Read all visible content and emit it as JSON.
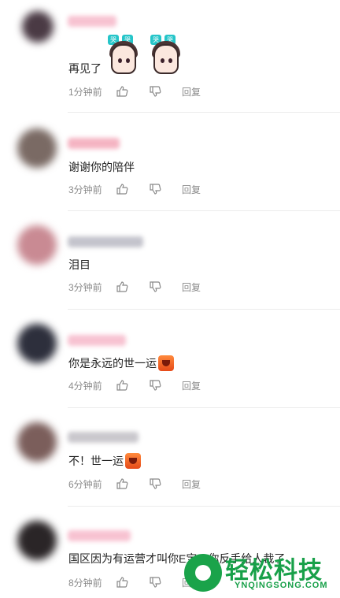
{
  "comments": [
    {
      "text": "再见了",
      "time": "1分钟前",
      "reply": "回复",
      "avatar_color": "#4a3a44",
      "name_color": "#f6b8c9",
      "stickers": [
        {
          "label": "哭"
        },
        {
          "label": "哭"
        }
      ]
    },
    {
      "text": "谢谢你的陪伴",
      "time": "3分钟前",
      "reply": "回复",
      "avatar_color": "#7a6a64",
      "name_color": "#f3a7b8"
    },
    {
      "text": "泪目",
      "time": "3分钟前",
      "reply": "回复",
      "avatar_color": "#c98a93",
      "name_color": "#b9b9c3"
    },
    {
      "text": "你是永远的世一运",
      "time": "4分钟前",
      "reply": "回复",
      "avatar_color": "#2d2f3c",
      "name_color": "#f6b8c9",
      "emoji": "crying-face"
    },
    {
      "text": "不！世一运",
      "time": "6分钟前",
      "reply": "回复",
      "avatar_color": "#7b5e5b",
      "name_color": "#c0bec4",
      "emoji": "crying-face"
    },
    {
      "text": "国区因为有运营才叫你E宝，你反手给人裁了",
      "time": "8分钟前",
      "reply": "回复",
      "avatar_color": "#2a2527",
      "name_color": "#f6b8c9"
    }
  ],
  "watermark": {
    "title": "轻松科技",
    "subtitle": "YNQINGSONG.COM"
  }
}
